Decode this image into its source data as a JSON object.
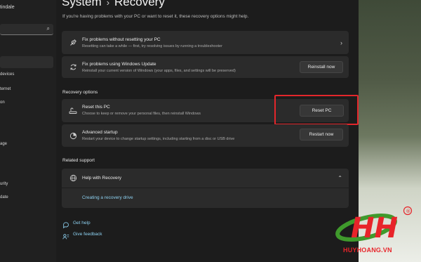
{
  "sidebar": {
    "profile_name": "tindale",
    "search_icon": "⌕",
    "items": [
      {
        "label": "devices"
      },
      {
        "label": "ternet"
      },
      {
        "label": "on"
      },
      {
        "label": "age"
      },
      {
        "label": "urity"
      },
      {
        "label": "date"
      }
    ]
  },
  "header": {
    "parent": "System",
    "separator": "›",
    "title": "Recovery"
  },
  "intro_text": "If you're having problems with your PC or want to reset it, these recovery options might help.",
  "troubleshoot_card": {
    "title": "Fix problems without resetting your PC",
    "desc": "Resetting can take a while — first, try resolving issues by running a troubleshooter",
    "icon": "wrench-icon"
  },
  "update_card": {
    "title": "Fix problems using Windows Update",
    "desc": "Reinstall your current version of Windows (your apps, files, and settings will be preserved)",
    "button": "Reinstall now",
    "icon": "refresh-icon"
  },
  "recovery_options_heading": "Recovery options",
  "reset_card": {
    "title": "Reset this PC",
    "desc": "Choose to keep or remove your personal files, then reinstall Windows",
    "button": "Reset PC",
    "icon": "reset-pc-icon"
  },
  "advanced_card": {
    "title": "Advanced startup",
    "desc": "Restart your device to change startup settings, including starting from a disc or USB drive",
    "button": "Restart now",
    "icon": "advanced-startup-icon"
  },
  "related_support_heading": "Related support",
  "help_card": {
    "title": "Help with Recovery",
    "link": "Creating a recovery drive",
    "icon": "globe-icon"
  },
  "footer_links": {
    "get_help": "Get help",
    "feedback": "Give feedback"
  },
  "watermark": {
    "brand": "HUYHOANG.VN",
    "registered": "®"
  },
  "colors": {
    "accent_link": "#8ed2f2",
    "highlight": "#e3262b",
    "brand_red": "#e8242a",
    "brand_green": "#3f9a2c"
  }
}
